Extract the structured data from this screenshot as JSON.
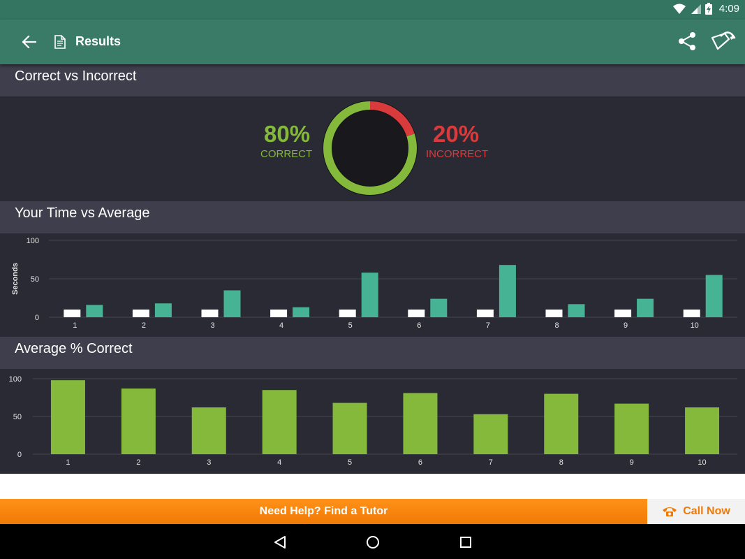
{
  "status_bar": {
    "time": "4:09"
  },
  "app_bar": {
    "title": "Results"
  },
  "sections": {
    "correct_vs_incorrect": "Correct vs Incorrect",
    "time_vs_average": "Your Time vs Average",
    "average_correct": "Average % Correct"
  },
  "summary": {
    "correct_pct_text": "80%",
    "correct_label": "CORRECT",
    "incorrect_pct_text": "20%",
    "incorrect_label": "INCORRECT",
    "correct_fraction": 0.8
  },
  "colors": {
    "app_bar": "#397b66",
    "correct": "#84b93b",
    "incorrect": "#d93b3d",
    "your_time": "#45b394",
    "average_time": "#ffffff",
    "cta_orange": "#f07a06"
  },
  "chart_data": [
    {
      "type": "bar",
      "title": "Your Time vs Average",
      "ylabel": "Seconds",
      "ylim": [
        0,
        100
      ],
      "yticks": [
        "0",
        "50",
        "100"
      ],
      "categories": [
        "1",
        "2",
        "3",
        "4",
        "5",
        "6",
        "7",
        "8",
        "9",
        "10"
      ],
      "series": [
        {
          "values": [
            10,
            10,
            10,
            10,
            10,
            10,
            10,
            10,
            10,
            10
          ]
        },
        {
          "values": [
            16,
            18,
            35,
            13,
            58,
            24,
            68,
            17,
            24,
            55
          ]
        }
      ],
      "grid": true
    },
    {
      "type": "bar",
      "title": "Average % Correct",
      "ylabel": "",
      "ylim": [
        0,
        100
      ],
      "yticks": [
        "0",
        "50",
        "100"
      ],
      "categories": [
        "1",
        "2",
        "3",
        "4",
        "5",
        "6",
        "7",
        "8",
        "9",
        "10"
      ],
      "values": [
        98,
        87,
        62,
        85,
        68,
        81,
        53,
        80,
        67,
        62
      ],
      "grid": true
    }
  ],
  "footer": {
    "tutor_text": "Need Help? Find a Tutor",
    "call_text": "Call Now"
  }
}
